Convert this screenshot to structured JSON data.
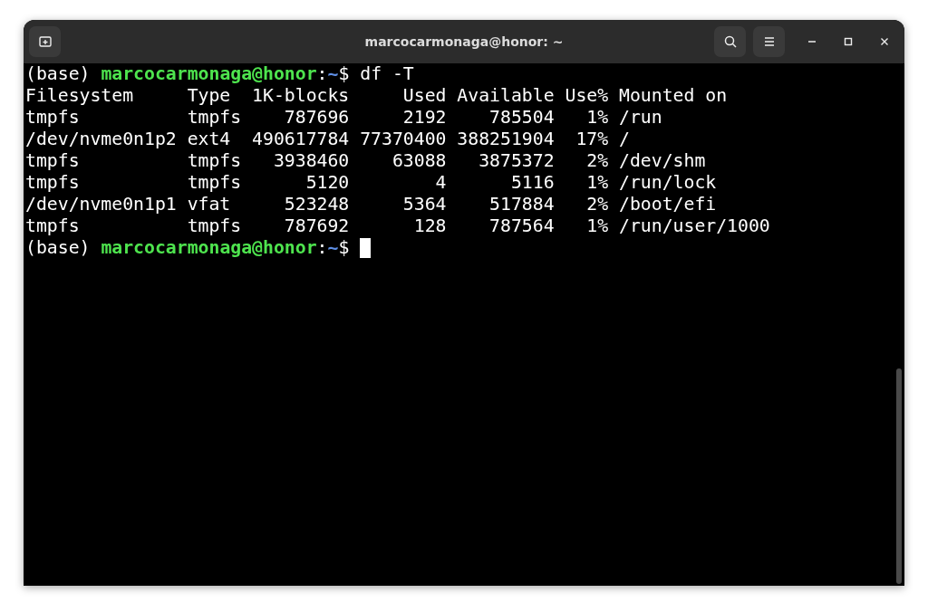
{
  "window": {
    "title": "marcocarmonaga@honor: ~"
  },
  "terminal": {
    "lines": [
      {
        "kind": "prompt",
        "env": "(base)",
        "user_host": "marcocarmonaga@honor",
        "separator": ":",
        "path": "~",
        "symbol": "$",
        "command": "df -T",
        "cursor": false
      },
      {
        "kind": "output",
        "text": "Filesystem     Type  1K-blocks     Used Available Use% Mounted on"
      },
      {
        "kind": "output",
        "text": "tmpfs          tmpfs    787696     2192    785504   1% /run"
      },
      {
        "kind": "output",
        "text": "/dev/nvme0n1p2 ext4  490617784 77370400 388251904  17% /"
      },
      {
        "kind": "output",
        "text": "tmpfs          tmpfs   3938460    63088   3875372   2% /dev/shm"
      },
      {
        "kind": "output",
        "text": "tmpfs          tmpfs      5120        4      5116   1% /run/lock"
      },
      {
        "kind": "output",
        "text": "/dev/nvme0n1p1 vfat     523248     5364    517884   2% /boot/efi"
      },
      {
        "kind": "output",
        "text": "tmpfs          tmpfs    787692      128    787564   1% /run/user/1000"
      },
      {
        "kind": "prompt",
        "env": "(base)",
        "user_host": "marcocarmonaga@honor",
        "separator": ":",
        "path": "~",
        "symbol": "$",
        "cursor": true
      }
    ]
  }
}
